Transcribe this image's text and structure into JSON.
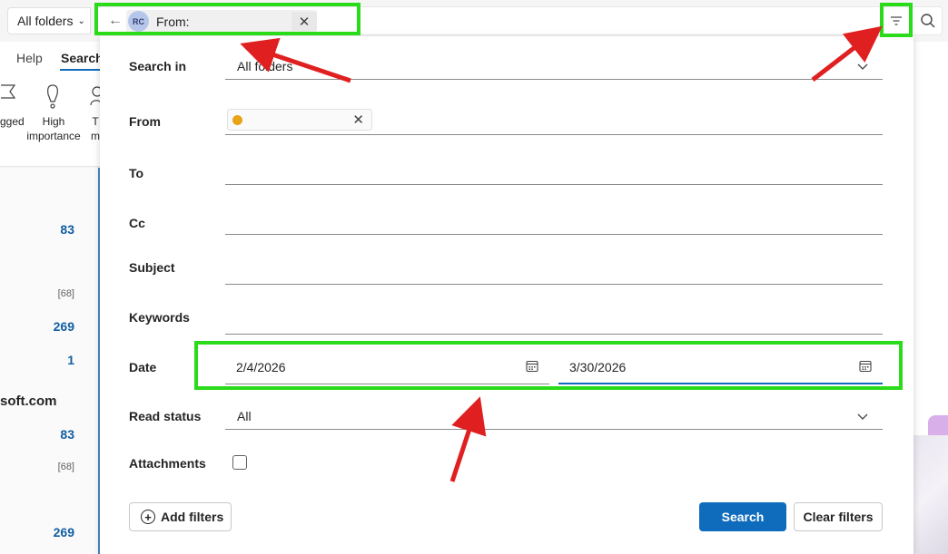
{
  "search_bar": {
    "folder_scope": "All folders",
    "chip_initials": "RC",
    "chip_label": "From:"
  },
  "ribbon": {
    "tabs": [
      "Help",
      "Search"
    ],
    "buttons": [
      {
        "label": "gged",
        "icon": "flag-icon"
      },
      {
        "label": "High importance",
        "icon": "exclamation-icon"
      },
      {
        "label": "T m",
        "icon": "person-icon"
      }
    ]
  },
  "background_list": {
    "counts": [
      "83",
      "[68]",
      "269",
      "1",
      "83",
      "[68]",
      "269"
    ],
    "domain": "soft.com"
  },
  "filter_panel": {
    "search_in": {
      "label": "Search in",
      "value": "All folders"
    },
    "from": {
      "label": "From"
    },
    "to": {
      "label": "To"
    },
    "cc": {
      "label": "Cc"
    },
    "subject": {
      "label": "Subject"
    },
    "keywords": {
      "label": "Keywords"
    },
    "date": {
      "label": "Date",
      "from": "2/4/2026",
      "to": "3/30/2026"
    },
    "read_status": {
      "label": "Read status",
      "value": "All"
    },
    "attachments": {
      "label": "Attachments",
      "checked": false
    },
    "add_filters_label": "Add filters",
    "search_label": "Search",
    "clear_filters_label": "Clear filters"
  },
  "colors": {
    "accent": "#0f6cbd",
    "highlight": "#2adb1a",
    "annotation_arrow": "#e02020",
    "avatar": "#b6c6ea",
    "chip_dot": "#e8a317"
  }
}
